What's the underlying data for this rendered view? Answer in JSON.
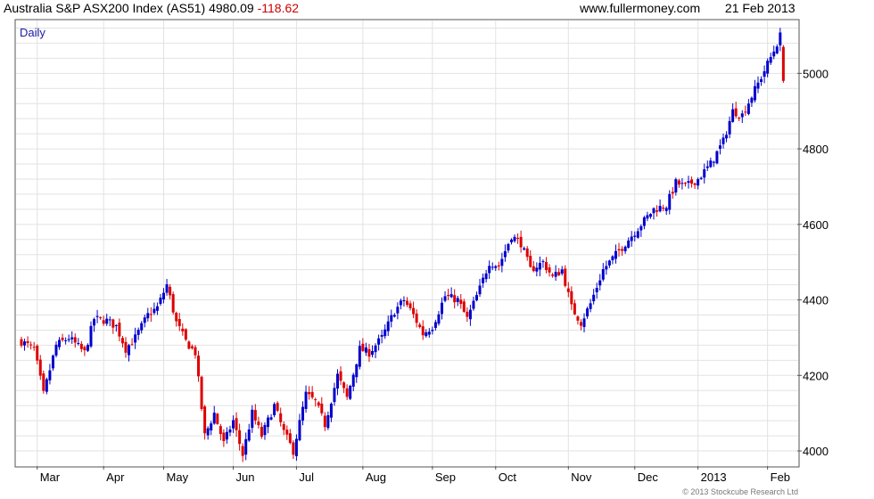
{
  "header": {
    "title": "Australia S&P ASX200 Index (AS51)",
    "last": "4980.09",
    "change": "-118.62",
    "site": "www.fullermoney.com",
    "date": "21 Feb 2013"
  },
  "colors": {
    "up": "#0000cc",
    "down": "#dd0000",
    "grid": "#e2e2e2",
    "axis": "#555555"
  },
  "chart_data": {
    "type": "candlestick",
    "title": "Australia S&P ASX200 Index (AS51) 4980.09 -118.62",
    "period_label": "Daily",
    "y_axis_side": "right",
    "ylim": [
      3960,
      5140
    ],
    "yticks": [
      4000,
      4200,
      4400,
      4600,
      4800,
      5000
    ],
    "x_range": [
      0,
      244
    ],
    "x_ticks": [
      {
        "label": "Mar",
        "x": 5
      },
      {
        "label": "Apr",
        "x": 26
      },
      {
        "label": "May",
        "x": 45
      },
      {
        "label": "Jun",
        "x": 67
      },
      {
        "label": "Jul",
        "x": 87
      },
      {
        "label": "Aug",
        "x": 108
      },
      {
        "label": "Sep",
        "x": 130
      },
      {
        "label": "Oct",
        "x": 150
      },
      {
        "label": "Nov",
        "x": 173
      },
      {
        "label": "Dec",
        "x": 194
      },
      {
        "label": "2013",
        "x": 214
      },
      {
        "label": "Feb",
        "x": 236
      }
    ],
    "grid": true,
    "anchors": [
      {
        "x": 0,
        "close": 4290
      },
      {
        "x": 4,
        "close": 4270
      },
      {
        "x": 7,
        "close": 4150
      },
      {
        "x": 11,
        "close": 4280
      },
      {
        "x": 15,
        "close": 4300
      },
      {
        "x": 20,
        "close": 4260
      },
      {
        "x": 23,
        "close": 4350
      },
      {
        "x": 27,
        "close": 4345
      },
      {
        "x": 30,
        "close": 4330
      },
      {
        "x": 33,
        "close": 4270
      },
      {
        "x": 36,
        "close": 4300
      },
      {
        "x": 40,
        "close": 4360
      },
      {
        "x": 43,
        "close": 4380
      },
      {
        "x": 46,
        "close": 4440
      },
      {
        "x": 49,
        "close": 4340
      },
      {
        "x": 52,
        "close": 4290
      },
      {
        "x": 55,
        "close": 4260
      },
      {
        "x": 58,
        "close": 4040
      },
      {
        "x": 61,
        "close": 4100
      },
      {
        "x": 64,
        "close": 4020
      },
      {
        "x": 67,
        "close": 4080
      },
      {
        "x": 70,
        "close": 3990
      },
      {
        "x": 73,
        "close": 4100
      },
      {
        "x": 76,
        "close": 4040
      },
      {
        "x": 80,
        "close": 4120
      },
      {
        "x": 83,
        "close": 4050
      },
      {
        "x": 86,
        "close": 4000
      },
      {
        "x": 90,
        "close": 4150
      },
      {
        "x": 93,
        "close": 4130
      },
      {
        "x": 96,
        "close": 4070
      },
      {
        "x": 100,
        "close": 4200
      },
      {
        "x": 103,
        "close": 4140
      },
      {
        "x": 107,
        "close": 4270
      },
      {
        "x": 110,
        "close": 4260
      },
      {
        "x": 114,
        "close": 4300
      },
      {
        "x": 118,
        "close": 4370
      },
      {
        "x": 121,
        "close": 4400
      },
      {
        "x": 124,
        "close": 4360
      },
      {
        "x": 127,
        "close": 4310
      },
      {
        "x": 130,
        "close": 4330
      },
      {
        "x": 134,
        "close": 4410
      },
      {
        "x": 138,
        "close": 4400
      },
      {
        "x": 141,
        "close": 4350
      },
      {
        "x": 145,
        "close": 4430
      },
      {
        "x": 148,
        "close": 4500
      },
      {
        "x": 151,
        "close": 4490
      },
      {
        "x": 155,
        "close": 4570
      },
      {
        "x": 158,
        "close": 4550
      },
      {
        "x": 161,
        "close": 4480
      },
      {
        "x": 165,
        "close": 4500
      },
      {
        "x": 168,
        "close": 4460
      },
      {
        "x": 171,
        "close": 4480
      },
      {
        "x": 174,
        "close": 4380
      },
      {
        "x": 177,
        "close": 4340
      },
      {
        "x": 180,
        "close": 4390
      },
      {
        "x": 184,
        "close": 4480
      },
      {
        "x": 188,
        "close": 4520
      },
      {
        "x": 192,
        "close": 4560
      },
      {
        "x": 196,
        "close": 4600
      },
      {
        "x": 200,
        "close": 4640
      },
      {
        "x": 204,
        "close": 4650
      },
      {
        "x": 207,
        "close": 4710
      },
      {
        "x": 210,
        "close": 4700
      },
      {
        "x": 214,
        "close": 4720
      },
      {
        "x": 218,
        "close": 4760
      },
      {
        "x": 222,
        "close": 4820
      },
      {
        "x": 225,
        "close": 4900
      },
      {
        "x": 228,
        "close": 4890
      },
      {
        "x": 231,
        "close": 4940
      },
      {
        "x": 234,
        "close": 4990
      },
      {
        "x": 238,
        "close": 5060
      },
      {
        "x": 240,
        "close": 5099
      },
      {
        "x": 241,
        "close": 4980.09
      }
    ],
    "last_bar": {
      "open": 5070,
      "high": 5075,
      "low": 4975,
      "close": 4980.09
    }
  },
  "footer": {
    "copyright": "© 2013 Stockcube Research Ltd"
  }
}
